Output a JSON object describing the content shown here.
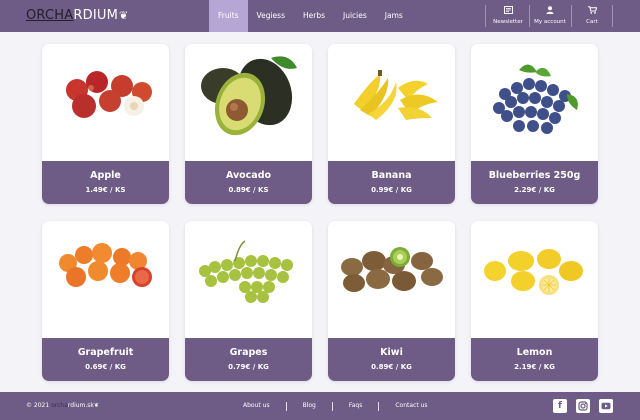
{
  "header": {
    "logo_dark": "ORCHA",
    "logo_light": "RDIUM",
    "nav": [
      {
        "label": "Fruits"
      },
      {
        "label": "Vegiess"
      },
      {
        "label": "Herbs"
      },
      {
        "label": "Juicies"
      },
      {
        "label": "Jams"
      }
    ],
    "account": {
      "newsletter": "Newsletter",
      "my_account": "My account",
      "cart": "Cart"
    },
    "icons": {
      "newsletter": "newspaper-icon",
      "my_account": "user-icon",
      "cart": "cart-icon",
      "logo": "leaf-icon"
    }
  },
  "products": [
    {
      "name": "Apple",
      "price": "1.49€ / KS"
    },
    {
      "name": "Avocado",
      "price": "0.89€ / KS"
    },
    {
      "name": "Banana",
      "price": "0.99€ / KG"
    },
    {
      "name": "Blueberries 250g",
      "price": "2.29€ / KG"
    },
    {
      "name": "Grapefruit",
      "price": "0.69€ / KG"
    },
    {
      "name": "Grapes",
      "price": "0.79€ / KG"
    },
    {
      "name": "Kiwi",
      "price": "0.89€ / KG"
    },
    {
      "name": "Lemon",
      "price": "2.19€ / KG"
    }
  ],
  "footer": {
    "copy_prefix": "© 2021",
    "copy_dim": "orcha",
    "copy_suffix": "rdium.sk",
    "links": [
      {
        "label": "About us"
      },
      {
        "label": "Blog"
      },
      {
        "label": "Faqs"
      },
      {
        "label": "Contact us"
      }
    ],
    "social": [
      "facebook-icon",
      "instagram-icon",
      "youtube-icon"
    ]
  },
  "colors": {
    "brand": "#6e5b86",
    "nav_active": "#b6a6d6",
    "page_bg": "#f4f3f7"
  }
}
